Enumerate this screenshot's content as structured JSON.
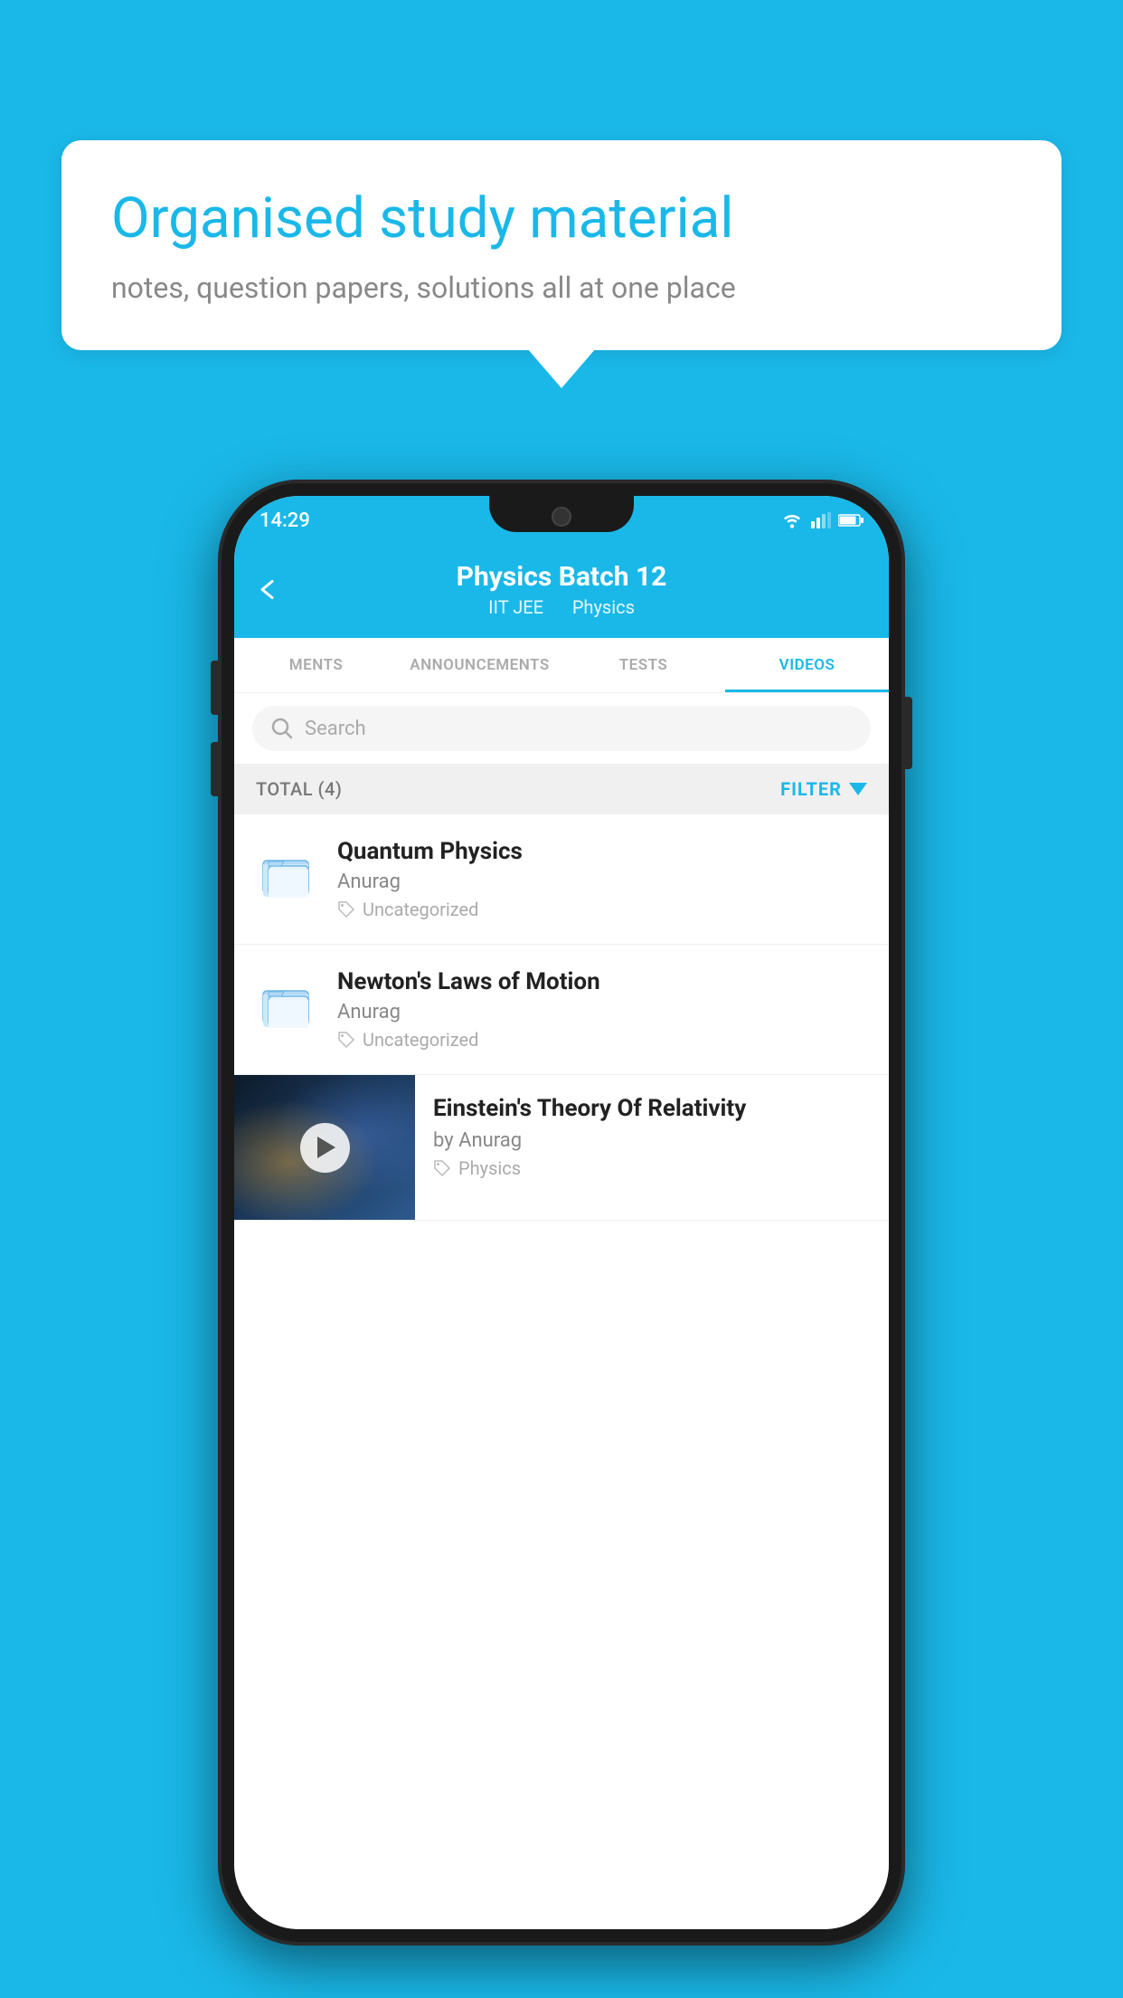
{
  "background": {
    "color": "#1ab8e8"
  },
  "bubble": {
    "title": "Organised study material",
    "subtitle": "notes, question papers, solutions all at one place"
  },
  "statusBar": {
    "time": "14:29",
    "wifiIcon": "wifi-icon",
    "signalIcon": "signal-icon",
    "batteryIcon": "battery-icon"
  },
  "header": {
    "title": "Physics Batch 12",
    "subtitle1": "IIT JEE",
    "subtitle2": "Physics",
    "backIcon": "back-arrow-icon"
  },
  "tabs": [
    {
      "label": "MENTS",
      "active": false
    },
    {
      "label": "ANNOUNCEMENTS",
      "active": false
    },
    {
      "label": "TESTS",
      "active": false
    },
    {
      "label": "VIDEOS",
      "active": true
    }
  ],
  "search": {
    "placeholder": "Search"
  },
  "filterBar": {
    "totalLabel": "TOTAL (4)",
    "filterLabel": "FILTER"
  },
  "items": [
    {
      "title": "Quantum Physics",
      "author": "Anurag",
      "tag": "Uncategorized",
      "type": "folder"
    },
    {
      "title": "Newton's Laws of Motion",
      "author": "Anurag",
      "tag": "Uncategorized",
      "type": "folder"
    },
    {
      "title": "Einstein's Theory Of Relativity",
      "author": "by Anurag",
      "tag": "Physics",
      "type": "video"
    }
  ]
}
